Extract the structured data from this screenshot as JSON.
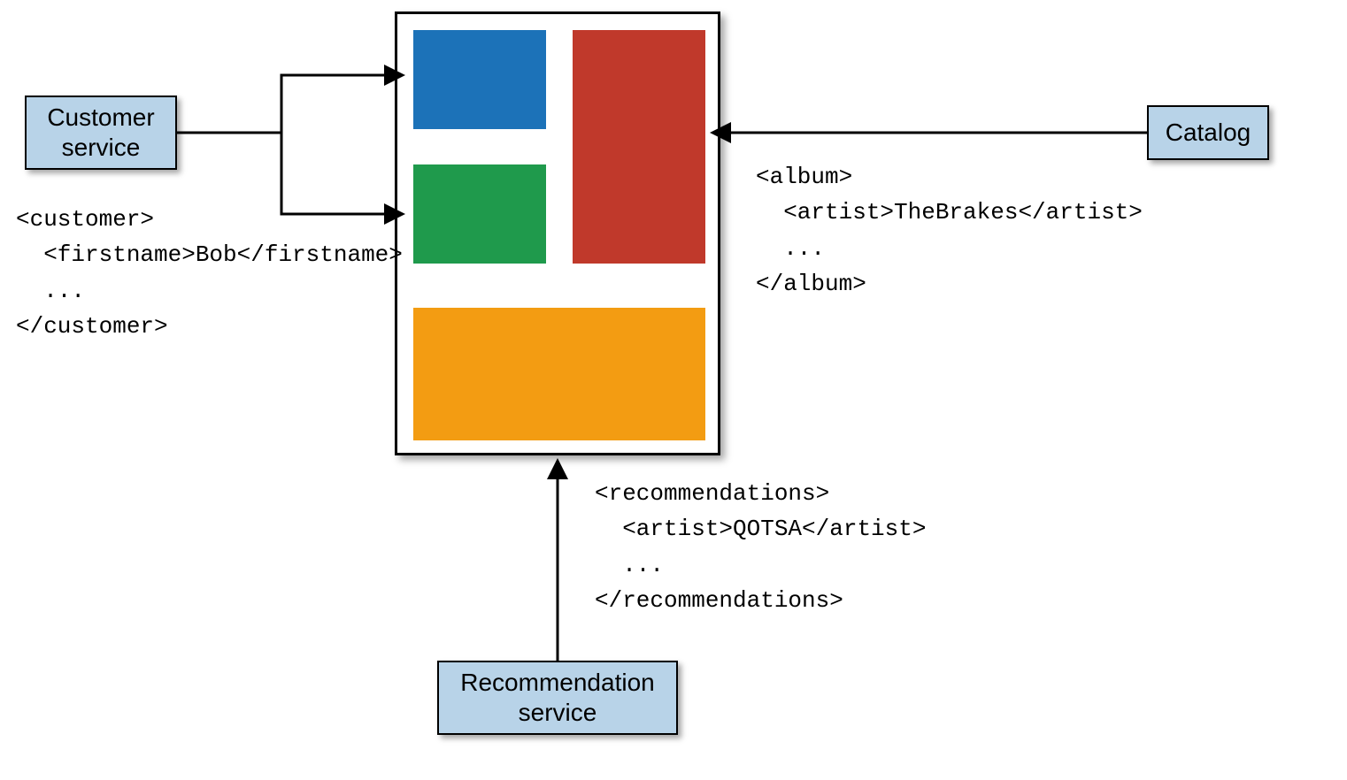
{
  "services": {
    "customer": {
      "label": "Customer\nservice"
    },
    "catalog": {
      "label": "Catalog"
    },
    "recommendation": {
      "label": "Recommendation\nservice"
    }
  },
  "snippets": {
    "customer": "<customer>\n  <firstname>Bob</firstname>\n  ...\n</customer>",
    "album": "<album>\n  <artist>TheBrakes</artist>\n  ...\n</album>",
    "recommendations": "<recommendations>\n  <artist>QOTSA</artist>\n  ...\n</recommendations>"
  },
  "colors": {
    "blue": "#1c72b8",
    "green": "#1f9a4c",
    "red": "#c0392b",
    "orange": "#f39c12",
    "serviceFill": "#b8d3e8"
  }
}
